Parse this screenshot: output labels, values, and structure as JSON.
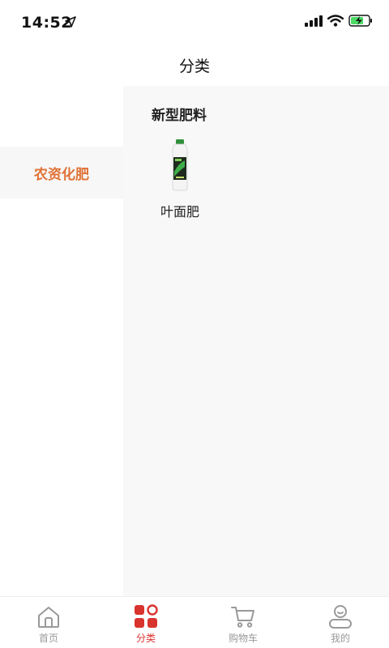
{
  "status": {
    "time": "14:52"
  },
  "nav": {
    "title": "分类"
  },
  "categories": [
    {
      "label": "农资化肥",
      "selected": true
    }
  ],
  "content": {
    "section_title": "新型肥料",
    "products": [
      {
        "label": "叶面肥"
      }
    ]
  },
  "tabs": [
    {
      "label": "首页",
      "icon": "home-icon",
      "active": false
    },
    {
      "label": "分类",
      "icon": "category-icon",
      "active": true
    },
    {
      "label": "购物车",
      "icon": "cart-icon",
      "active": false
    },
    {
      "label": "我的",
      "icon": "profile-icon",
      "active": false
    }
  ],
  "colors": {
    "accent": "#d9332e",
    "selected_category": "#e07236",
    "tab_inactive": "#999999"
  }
}
